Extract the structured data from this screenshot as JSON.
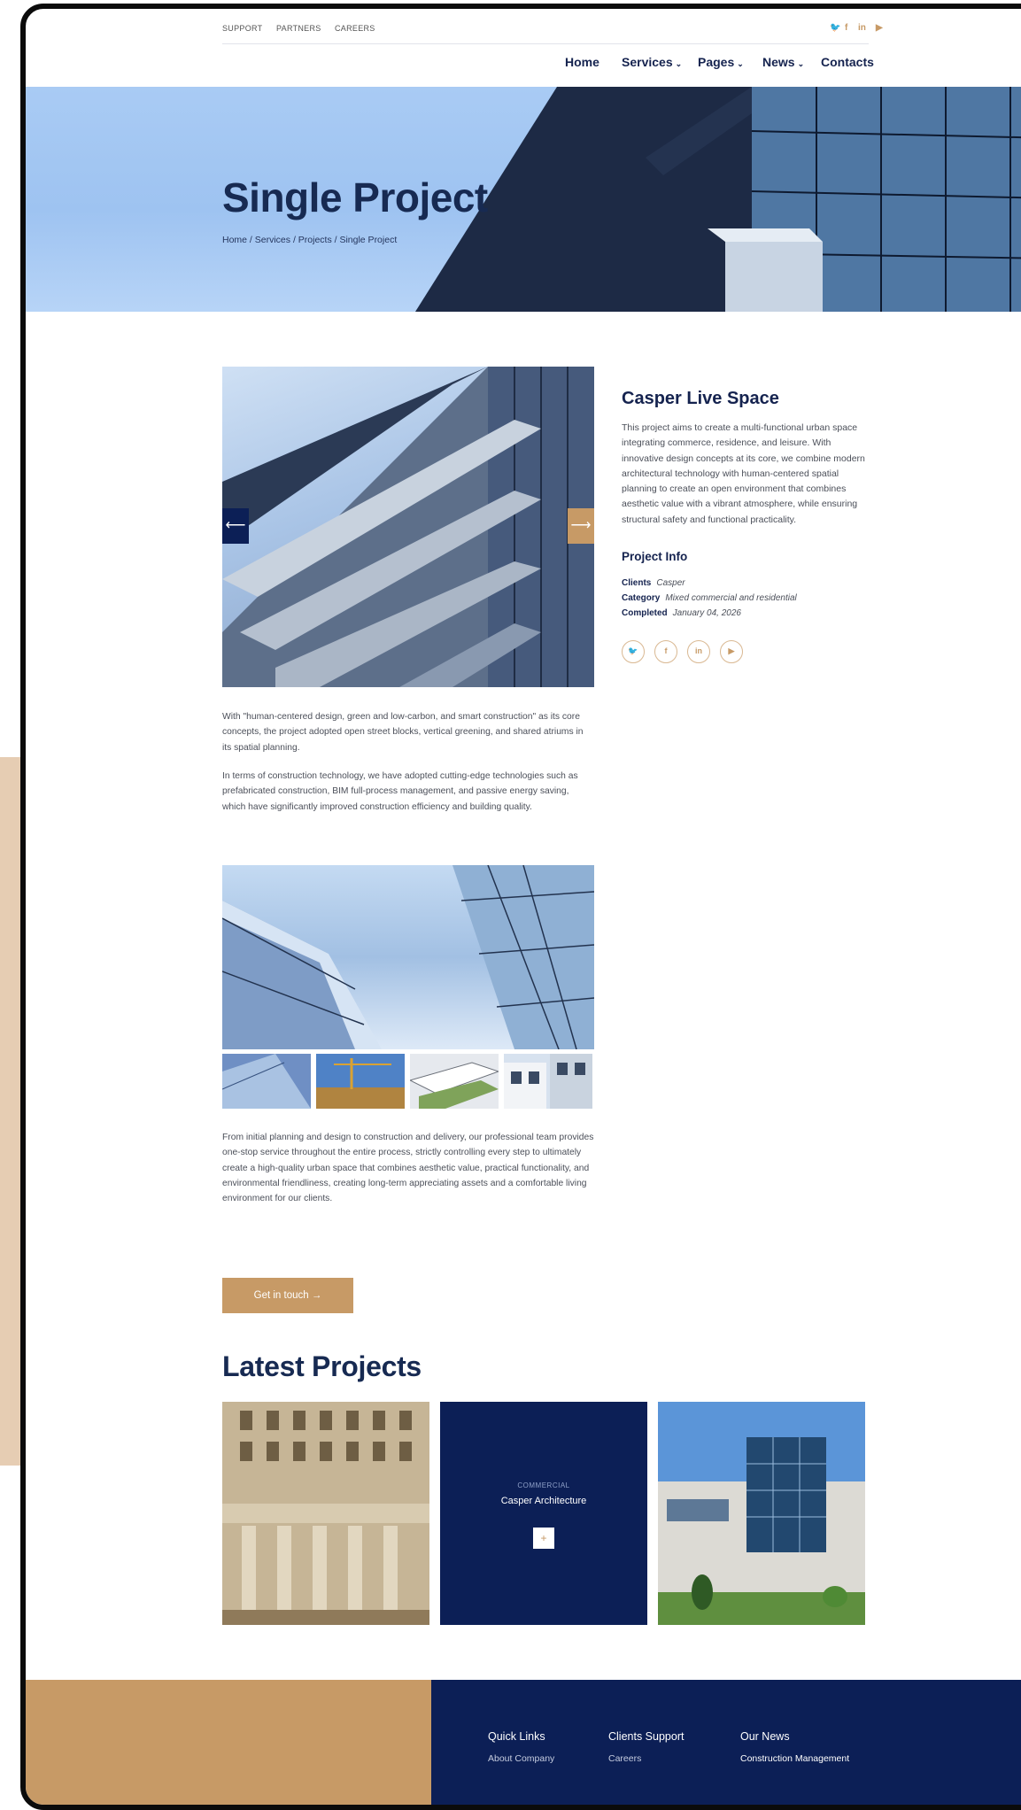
{
  "topbar": {
    "links": [
      "SUPPORT",
      "PARTNERS",
      "CAREERS"
    ],
    "social": [
      "twitter-icon",
      "facebook-icon",
      "linkedin-icon",
      "youtube-icon"
    ]
  },
  "nav": {
    "items": [
      {
        "label": "Home",
        "dropdown": false
      },
      {
        "label": "Services",
        "dropdown": true
      },
      {
        "label": "Pages",
        "dropdown": true
      },
      {
        "label": "News",
        "dropdown": true
      },
      {
        "label": "Contacts",
        "dropdown": false
      }
    ]
  },
  "hero": {
    "title": "Single Project",
    "breadcrumb": "Home / Services / Projects / Single Project"
  },
  "gallery": {
    "prev_icon": "⟵",
    "next_icon": "⟶"
  },
  "project": {
    "title": "Casper Live Space",
    "description": "This project aims to create a multi-functional urban space integrating commerce, residence, and leisure. With innovative design concepts at its core, we combine modern architectural technology with human-centered spatial planning to create an open environment that combines aesthetic value with a vibrant atmosphere, while ensuring structural safety and functional practicality.",
    "info_title": "Project Info",
    "info": [
      {
        "label": "Clients",
        "value": "Casper"
      },
      {
        "label": "Category",
        "value": "Mixed commercial and residential"
      },
      {
        "label": "Completed",
        "value": "January 04, 2026"
      }
    ],
    "social_icons": [
      {
        "name": "twitter-icon",
        "glyph": "🐦"
      },
      {
        "name": "facebook-icon",
        "glyph": "f"
      },
      {
        "name": "linkedin-icon",
        "glyph": "in"
      },
      {
        "name": "youtube-icon",
        "glyph": "▶"
      }
    ]
  },
  "content": {
    "para1": "With \"human-centered design, green and low-carbon, and smart construction\" as its core concepts, the project adopted open street blocks, vertical greening, and shared atriums in its spatial planning.",
    "para2": "In terms of construction technology, we have adopted cutting-edge technologies such as prefabricated construction, BIM full-process management, and passive energy saving, which have significantly improved construction efficiency and building quality.",
    "para3": "From initial planning and design to construction and delivery, our professional team provides one-stop service throughout the entire process, strictly controlling every step to ultimately create a high-quality urban space that combines aesthetic value, practical functionality, and environmental friendliness, creating long-term appreciating assets and a comfortable living environment for our clients.",
    "cta": "Get in touch →"
  },
  "latest": {
    "title": "Latest Projects",
    "featured": {
      "category": "COMMERCIAL",
      "name": "Casper Architecture",
      "plus": "+"
    }
  },
  "footer": {
    "columns": [
      {
        "title": "Quick Links",
        "first_link": "About Company"
      },
      {
        "title": "Clients Support",
        "first_link": "Careers"
      },
      {
        "title": "Our News",
        "first_link": "Construction Management"
      }
    ]
  },
  "colors": {
    "navy": "#0c1f56",
    "accent": "#c79a66",
    "sky": "#a9cbf4"
  }
}
